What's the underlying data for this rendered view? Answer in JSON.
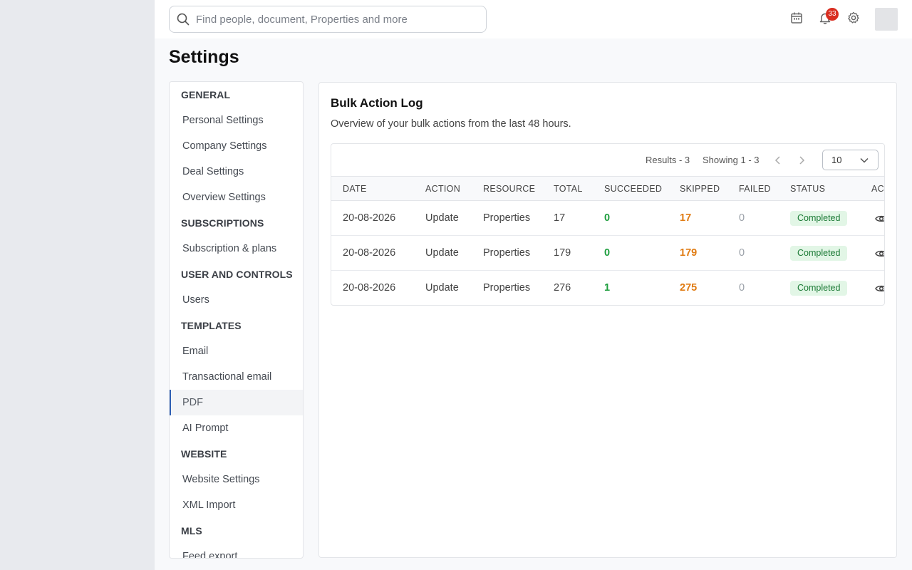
{
  "topbar": {
    "search_placeholder": "Find people, document, Properties and more",
    "notification_count": "33",
    "icons": [
      "search-icon",
      "calendar-icon",
      "bell-icon",
      "gear-icon"
    ]
  },
  "page": {
    "title": "Settings"
  },
  "nav": {
    "items": [
      {
        "type": "section",
        "label": "GENERAL"
      },
      {
        "type": "item",
        "label": "Personal Settings"
      },
      {
        "type": "item",
        "label": "Company Settings"
      },
      {
        "type": "item",
        "label": "Deal Settings"
      },
      {
        "type": "item",
        "label": "Overview Settings"
      },
      {
        "type": "section",
        "label": "SUBSCRIPTIONS"
      },
      {
        "type": "item",
        "label": "Subscription & plans"
      },
      {
        "type": "section",
        "label": "USER AND CONTROLS"
      },
      {
        "type": "item",
        "label": "Users"
      },
      {
        "type": "section",
        "label": "TEMPLATES"
      },
      {
        "type": "item",
        "label": "Email"
      },
      {
        "type": "item",
        "label": "Transactional email"
      },
      {
        "type": "item",
        "label": "PDF",
        "active": true
      },
      {
        "type": "item",
        "label": "AI Prompt"
      },
      {
        "type": "section",
        "label": "WEBSITE"
      },
      {
        "type": "item",
        "label": "Website Settings"
      },
      {
        "type": "item",
        "label": "XML Import"
      },
      {
        "type": "section",
        "label": "MLS"
      },
      {
        "type": "item",
        "label": "Feed export"
      }
    ]
  },
  "card": {
    "title": "Bulk Action Log",
    "subtitle": "Overview of your bulk actions from the last 48 hours."
  },
  "pager": {
    "results": "Results - 3",
    "showing": "Showing 1 - 3",
    "page_size": "10"
  },
  "table": {
    "columns": [
      "DATE",
      "ACTION",
      "RESOURCE",
      "TOTAL",
      "SUCCEEDED",
      "SKIPPED",
      "FAILED",
      "STATUS",
      "ACTIONS"
    ],
    "rows": [
      {
        "date": "20-08-2026",
        "action": "Update",
        "resource": "Properties",
        "total": "17",
        "succeeded": "0",
        "skipped": "17",
        "failed": "0",
        "status": "Completed"
      },
      {
        "date": "20-08-2026",
        "action": "Update",
        "resource": "Properties",
        "total": "179",
        "succeeded": "0",
        "skipped": "179",
        "failed": "0",
        "status": "Completed"
      },
      {
        "date": "20-08-2026",
        "action": "Update",
        "resource": "Properties",
        "total": "276",
        "succeeded": "1",
        "skipped": "275",
        "failed": "0",
        "status": "Completed"
      }
    ]
  },
  "colors": {
    "accent": "#2f5fb3",
    "success": "#1e9e3e",
    "warning": "#e07b12",
    "badge": "#d92d20"
  }
}
